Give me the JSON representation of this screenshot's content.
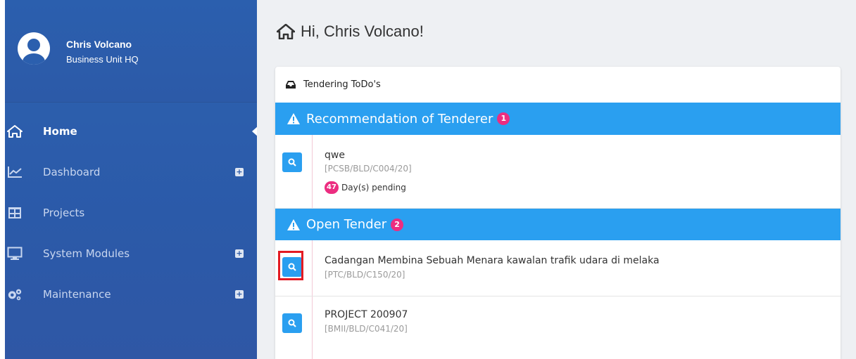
{
  "user": {
    "name": "Chris Volcano",
    "unit": "Business Unit HQ"
  },
  "nav": {
    "items": [
      {
        "label": "Home",
        "icon": "home-icon",
        "active": true,
        "expandable": false
      },
      {
        "label": "Dashboard",
        "icon": "chart-line-icon",
        "active": false,
        "expandable": true
      },
      {
        "label": "Projects",
        "icon": "table-icon",
        "active": false,
        "expandable": false
      },
      {
        "label": "System Modules",
        "icon": "desktop-icon",
        "active": false,
        "expandable": true
      },
      {
        "label": "Maintenance",
        "icon": "gears-icon",
        "active": false,
        "expandable": true
      }
    ],
    "expand_symbol": "+"
  },
  "greeting": "Hi, Chris Volcano!",
  "card": {
    "title": "Tendering ToDo's",
    "sections": [
      {
        "title": "Recommendation of Tenderer",
        "count": "1",
        "items": [
          {
            "title": "qwe",
            "code": "[PCSB/BLD/C004/20]",
            "pending_days": "47",
            "pending_label": "Day(s) pending"
          }
        ]
      },
      {
        "title": "Open Tender",
        "count": "2",
        "items": [
          {
            "title": "Cadangan Membina Sebuah Menara kawalan trafik udara di melaka",
            "code": "[PTC/BLD/C150/20]"
          },
          {
            "title": "PROJECT 200907",
            "code": "[BMII/BLD/C041/20]"
          }
        ]
      }
    ]
  },
  "colors": {
    "sidebar": "#2d5fae",
    "section_bar": "#2a9ff0",
    "badge": "#ec2d80",
    "highlight": "#e31b23"
  }
}
